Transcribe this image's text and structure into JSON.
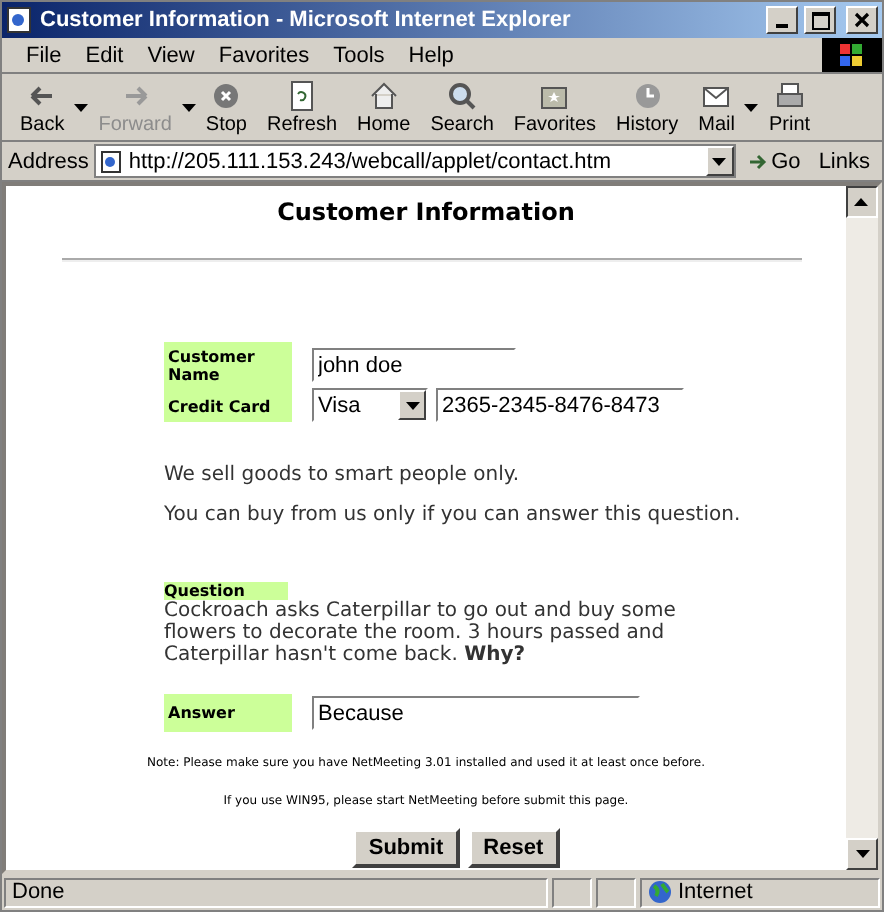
{
  "window": {
    "title": "Customer Information - Microsoft Internet Explorer"
  },
  "menu": [
    "File",
    "Edit",
    "View",
    "Favorites",
    "Tools",
    "Help"
  ],
  "toolbar": [
    {
      "label": "Back",
      "kind": "back",
      "disabled": false,
      "dropdown": true
    },
    {
      "label": "Forward",
      "kind": "forward",
      "disabled": true,
      "dropdown": true
    },
    {
      "label": "Stop",
      "kind": "stop",
      "disabled": false,
      "dropdown": false
    },
    {
      "label": "Refresh",
      "kind": "refresh",
      "disabled": false,
      "dropdown": false
    },
    {
      "label": "Home",
      "kind": "home",
      "disabled": false,
      "dropdown": false
    },
    {
      "label": "Search",
      "kind": "search",
      "disabled": false,
      "dropdown": false
    },
    {
      "label": "Favorites",
      "kind": "favorites",
      "disabled": false,
      "dropdown": false
    },
    {
      "label": "History",
      "kind": "history",
      "disabled": false,
      "dropdown": false
    },
    {
      "label": "Mail",
      "kind": "mail",
      "disabled": false,
      "dropdown": true
    },
    {
      "label": "Print",
      "kind": "print",
      "disabled": false,
      "dropdown": false
    }
  ],
  "address_bar": {
    "label": "Address",
    "url": "http://205.111.153.243/webcall/applet/contact.htm",
    "go": "Go",
    "links": "Links"
  },
  "page": {
    "heading": "Customer Information",
    "form": {
      "name_label": "Customer Name",
      "name_value": "john doe",
      "card_label": "Credit Card",
      "card_type": "Visa",
      "card_number": "2365-2345-8476-8473"
    },
    "intro": [
      "We sell goods to smart people only.",
      "You can buy from us only if you can answer this question."
    ],
    "question_label": "Question",
    "question": "Cockroach asks Caterpillar to go out and buy some flowers to decorate the room.  3 hours passed and Caterpillar hasn't come back.  **Why?**",
    "answer_label": "Answer",
    "answer_value": "Because",
    "note": "Note: Please make sure you have NetMeeting 3.01 installed and used it at least once before.",
    "note2": "If you use WIN95, please start NetMeeting before submit this page.",
    "buttons": [
      "Submit",
      "Reset"
    ]
  },
  "status_bar": {
    "text": "Done",
    "zone": "Internet"
  }
}
